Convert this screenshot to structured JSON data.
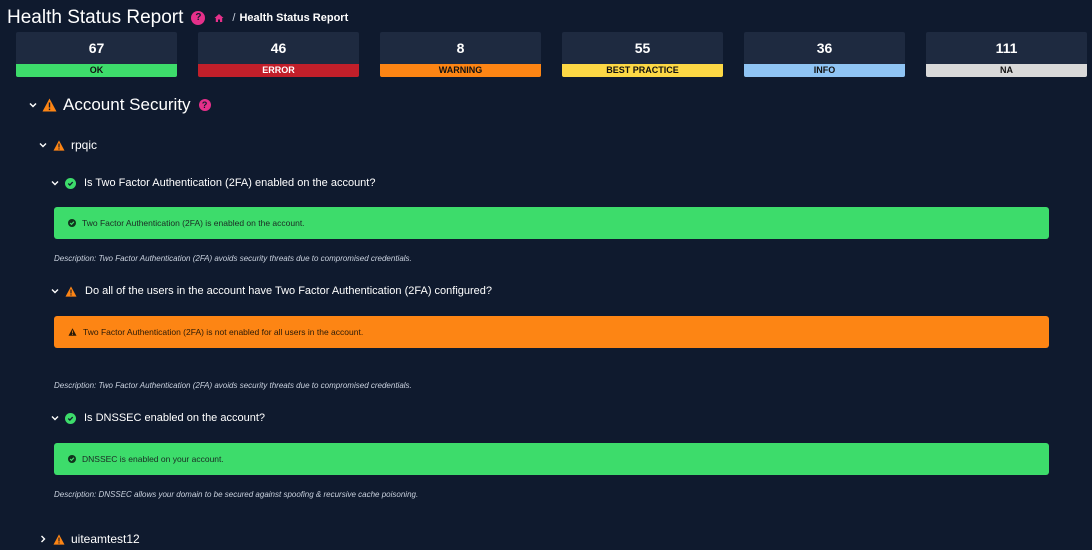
{
  "header": {
    "title": "Health Status Report",
    "breadcrumb_separator": "/",
    "breadcrumb_current": "Health Status Report"
  },
  "stats": [
    {
      "value": "67",
      "label": "OK",
      "color": "#3ddc6b",
      "label_color": "#111111"
    },
    {
      "value": "46",
      "label": "ERROR",
      "color": "#c21f2a",
      "label_color": "#ffffff"
    },
    {
      "value": "8",
      "label": "WARNING",
      "color": "#fd8514",
      "label_color": "#111111"
    },
    {
      "value": "55",
      "label": "BEST PRACTICE",
      "color": "#fdd845",
      "label_color": "#111111"
    },
    {
      "value": "36",
      "label": "INFO",
      "color": "#8fc4f4",
      "label_color": "#111111"
    },
    {
      "value": "111",
      "label": "NA",
      "color": "#d9d9d9",
      "label_color": "#111111"
    }
  ],
  "section": {
    "title": "Account Security",
    "accounts": [
      {
        "name": "rpqic",
        "checks": [
          {
            "question": "Is Two Factor Authentication (2FA) enabled on the account?",
            "result": "Two Factor Authentication (2FA) is enabled on the account.",
            "description": "Description: Two Factor Authentication (2FA) avoids security threats due to compromised credentials."
          },
          {
            "question": "Do all of the users in the account have Two Factor Authentication (2FA) configured?",
            "result": "Two Factor Authentication (2FA) is not enabled for all users in the account.",
            "description": "Description: Two Factor Authentication (2FA) avoids security threats due to compromised credentials."
          },
          {
            "question": "Is DNSSEC enabled on the account?",
            "result": "DNSSEC is enabled on your account.",
            "description": "Description: DNSSEC allows your domain to be secured against spoofing & recursive cache poisoning."
          }
        ]
      },
      {
        "name": "uiteamtest12"
      }
    ]
  },
  "icons": {
    "help": "question-circle-icon",
    "help_glyph": "?",
    "home": "home-icon",
    "warning": "warning-triangle-icon",
    "ok": "check-circle-icon",
    "expanded": "chevron-down-icon",
    "collapsed": "chevron-right-icon"
  },
  "colors": {
    "background": "#0f1a2e",
    "card": "#1e2a40",
    "accent_pink": "#e5308a",
    "ok": "#3ddc6b",
    "warning": "#fd8514"
  }
}
